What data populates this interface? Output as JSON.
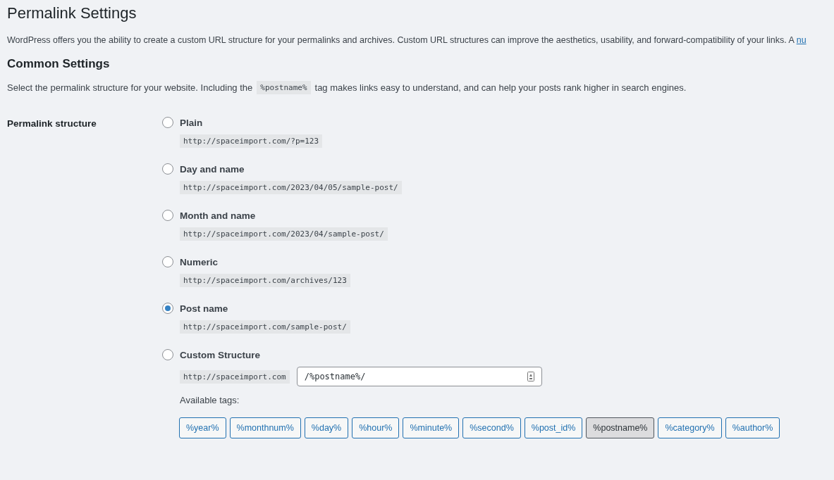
{
  "title": "Permalink Settings",
  "intro": {
    "text": "WordPress offers you the ability to create a custom URL structure for your permalinks and archives. Custom URL structures can improve the aesthetics, usability, and forward-compatibility of your links. A",
    "link": "nu"
  },
  "section_title": "Common Settings",
  "section_intro": {
    "before": "Select the permalink structure for your website. Including the",
    "code": "%postname%",
    "after": "tag makes links easy to understand, and can help your posts rank higher in search engines."
  },
  "field_label": "Permalink structure",
  "options": [
    {
      "label": "Plain",
      "example": "http://spaceimport.com/?p=123",
      "selected": false
    },
    {
      "label": "Day and name",
      "example": "http://spaceimport.com/2023/04/05/sample-post/",
      "selected": false
    },
    {
      "label": "Month and name",
      "example": "http://spaceimport.com/2023/04/sample-post/",
      "selected": false
    },
    {
      "label": "Numeric",
      "example": "http://spaceimport.com/archives/123",
      "selected": false
    },
    {
      "label": "Post name",
      "example": "http://spaceimport.com/sample-post/",
      "selected": true
    },
    {
      "label": "Custom Structure",
      "prefix": "http://spaceimport.com",
      "value": "/%postname%/",
      "selected": false
    }
  ],
  "tags_label": "Available tags:",
  "tags": [
    {
      "label": "%year%",
      "selected": false
    },
    {
      "label": "%monthnum%",
      "selected": false
    },
    {
      "label": "%day%",
      "selected": false
    },
    {
      "label": "%hour%",
      "selected": false
    },
    {
      "label": "%minute%",
      "selected": false
    },
    {
      "label": "%second%",
      "selected": false
    },
    {
      "label": "%post_id%",
      "selected": false
    },
    {
      "label": "%postname%",
      "selected": true
    },
    {
      "label": "%category%",
      "selected": false
    },
    {
      "label": "%author%",
      "selected": false
    }
  ]
}
